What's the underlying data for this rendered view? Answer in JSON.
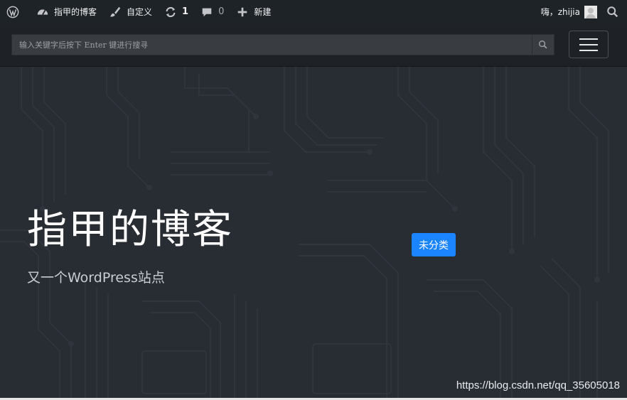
{
  "adminbar": {
    "site_name": "指甲的博客",
    "customize_label": "自定义",
    "updates_count": "1",
    "comments_count": "0",
    "new_label": "新建",
    "greeting": "嗨，zhijia"
  },
  "header": {
    "search_placeholder": "输入关键字后按下 Enter 键进行搜寻"
  },
  "hero": {
    "title": "指甲的博客",
    "tagline": "又一个WordPress站点",
    "category_badge": "未分类"
  },
  "watermark": "https://blog.csdn.net/qq_35605018",
  "colors": {
    "adminbar_bg": "#1d2327",
    "navbar_bg": "#1e2226",
    "hero_bg": "#282c33",
    "badge_bg": "#1b84ff"
  },
  "icons": [
    "wordpress-icon",
    "dashboard-icon",
    "brush-icon",
    "updates-icon",
    "comments-icon",
    "plus-icon",
    "avatar",
    "search-icon",
    "hamburger-icon"
  ]
}
